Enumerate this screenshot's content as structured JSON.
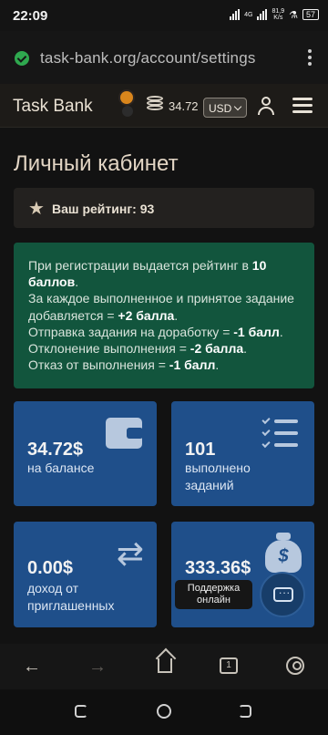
{
  "status_bar": {
    "time": "22:09",
    "network": "4G",
    "speed": "81,9",
    "speed_unit": "K/s",
    "battery": "57"
  },
  "browser": {
    "url": "task-bank.org/account/settings"
  },
  "header": {
    "logo": "Task Bank",
    "balance": "34.72",
    "currency": "USD"
  },
  "page": {
    "title": "Личный кабинет",
    "rating_label": "Ваш рейтинг: 93"
  },
  "info": {
    "line1_pre": "При регистрации выдается рейтинг в ",
    "line1_bold": "10 баллов",
    "line1_post": ".",
    "line2_pre": "За каждое выполненное и принятое задание добавляется = ",
    "line2_bold": "+2 балла",
    "line2_post": ".",
    "line3_pre": "Отправка задания на доработку = ",
    "line3_bold": "-1 балл",
    "line3_post": ".",
    "line4_pre": "Отклонение выполнения = ",
    "line4_bold": "-2 балла",
    "line4_post": ".",
    "line5_pre": "Отказ от выполнения = ",
    "line5_bold": "-1 балл",
    "line5_post": "."
  },
  "cards": [
    {
      "value": "34.72$",
      "label": "на балансе",
      "icon": "wallet-icon"
    },
    {
      "value": "101",
      "label": "выполнено заданий",
      "icon": "checklist-icon"
    },
    {
      "value": "0.00$",
      "label": "доход от приглашенных",
      "icon": "repeat-icon"
    },
    {
      "value": "333.36$",
      "label": "",
      "icon": "money-bag-icon"
    }
  ],
  "support": {
    "tooltip": "Поддержка онлайн"
  },
  "browser_nav": {
    "tabs_count": "1"
  },
  "colors": {
    "background": "#121212",
    "info_box": "#12553d",
    "card": "#1f4f8a",
    "accent": "#d9861c"
  }
}
